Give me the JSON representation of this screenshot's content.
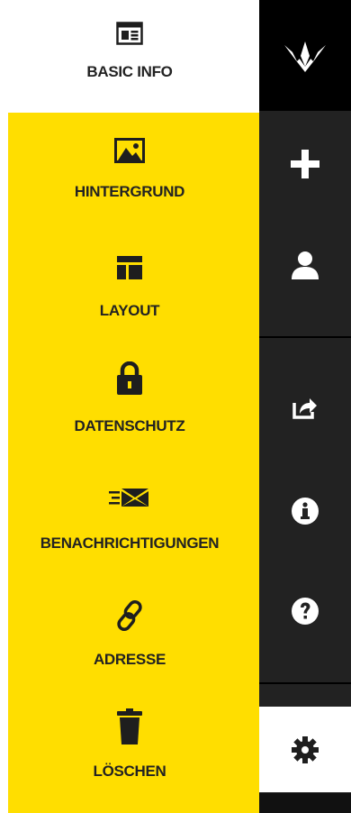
{
  "menu": {
    "items": [
      {
        "label": "BASIC INFO",
        "icon": "newspaper-icon"
      },
      {
        "label": "HINTERGRUND",
        "icon": "image-icon"
      },
      {
        "label": "LAYOUT",
        "icon": "layout-icon"
      },
      {
        "label": "DATENSCHUTZ",
        "icon": "lock-icon"
      },
      {
        "label": "BENACHRICHTIGUNGEN",
        "icon": "envelope-icon"
      },
      {
        "label": "ADRESSE",
        "icon": "link-icon"
      },
      {
        "label": "LÖSCHEN",
        "icon": "trash-icon"
      }
    ],
    "active_item": "BASIC INFO",
    "colors": {
      "panel_highlight": "#ffde00",
      "text": "#222222"
    }
  },
  "rail": {
    "buttons": [
      {
        "name": "logo",
        "icon": "paper-crane-icon"
      },
      {
        "name": "add",
        "icon": "plus-icon"
      },
      {
        "name": "profile",
        "icon": "user-icon"
      },
      {
        "name": "share",
        "icon": "share-icon"
      },
      {
        "name": "info",
        "icon": "info-icon"
      },
      {
        "name": "help",
        "icon": "question-icon"
      },
      {
        "name": "settings",
        "icon": "gear-icon"
      }
    ],
    "active_button": "settings",
    "colors": {
      "background": "#222222",
      "logo_bg": "#000000"
    }
  }
}
